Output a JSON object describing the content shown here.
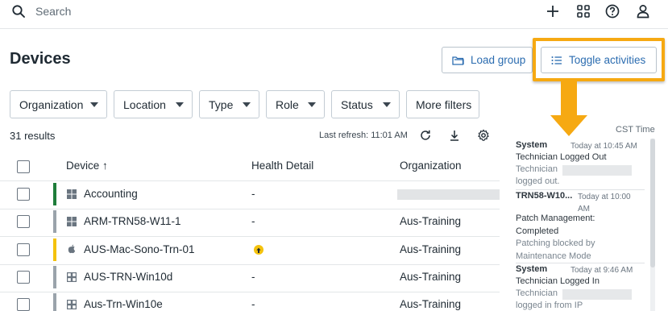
{
  "search": {
    "placeholder": "Search"
  },
  "header": {
    "title": "Devices",
    "load_group_label": "Load group",
    "toggle_activities_label": "Toggle activities"
  },
  "filters": [
    {
      "label": "Organization"
    },
    {
      "label": "Location"
    },
    {
      "label": "Type"
    },
    {
      "label": "Role"
    },
    {
      "label": "Status"
    }
  ],
  "more_filters_label": "More filters",
  "results_text": "31 results",
  "last_refresh": "Last refresh: 11:01 AM",
  "table": {
    "columns": [
      "Device ↑",
      "Health Detail",
      "Organization"
    ],
    "rows": [
      {
        "device": "Accounting",
        "os": "windows",
        "status_color": "#1e7d3a",
        "health": "-",
        "organization": ""
      },
      {
        "device": "ARM-TRN58-W11-1",
        "os": "windows",
        "status_color": "#9aa3ab",
        "health": "-",
        "organization": "Aus-Training"
      },
      {
        "device": "AUS-Mac-Sono-Trn-01",
        "os": "apple",
        "status_color": "#f4c20d",
        "health": "",
        "organization": "Aus-Training"
      },
      {
        "device": "AUS-TRN-Win10d",
        "os": "windows-outline",
        "status_color": "#9aa3ab",
        "health": "-",
        "organization": "Aus-Training"
      },
      {
        "device": "Aus-Trn-Win10e",
        "os": "windows-outline",
        "status_color": "#9aa3ab",
        "health": "-",
        "organization": "Aus-Training"
      }
    ]
  },
  "activity_panel": {
    "timezone": "CST Time",
    "items": [
      {
        "source": "System",
        "time": "Today at 10:45 AM",
        "title": "Technician Logged Out",
        "line1": "Technician",
        "line2": "logged out."
      },
      {
        "source": "TRN58-W10...",
        "time": "Today at 10:00",
        "time2": "AM",
        "title": "Patch Management:",
        "title2": "Completed",
        "line1": "Patching blocked by",
        "line2": "Maintenance Mode"
      },
      {
        "source": "System",
        "time": "Today at 9:46 AM",
        "title": "Technician Logged In",
        "line1": "Technician",
        "line2": "logged in from IP"
      }
    ]
  },
  "colors": {
    "accent": "#2b6cb0",
    "highlight": "#f6a912"
  },
  "icons": [
    "search-icon",
    "plus-icon",
    "grid-icon",
    "help-icon",
    "user-icon",
    "folder-icon",
    "list-icon",
    "refresh-icon",
    "download-icon",
    "settings-icon"
  ]
}
